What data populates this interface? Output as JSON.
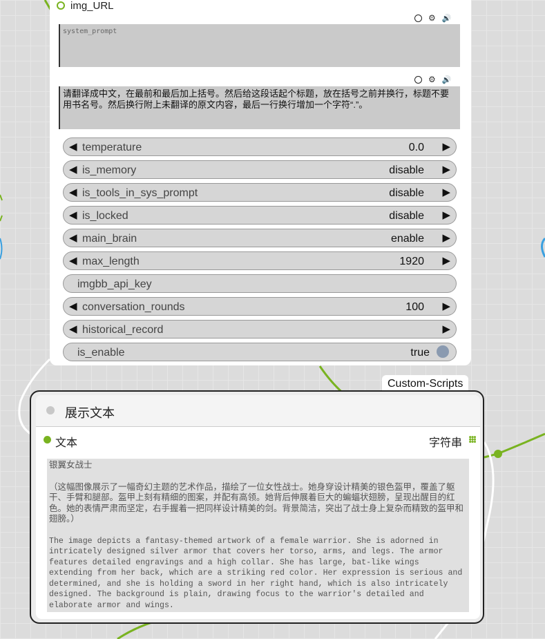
{
  "top_node": {
    "input": {
      "label": "img_URL"
    },
    "system_prompt": {
      "value": "system_prompt"
    },
    "user_prompt": {
      "value": "请翻译成中文，在最前和最后加上括号。然后给这段话起个标题，放在括号之前并换行，标题不要用书名号。然后换行附上未翻译的原文内容，最后一行换行增加一个字符“.”。"
    },
    "widgets": [
      {
        "label": "temperature",
        "value": "0.0"
      },
      {
        "label": "is_memory",
        "value": "disable"
      },
      {
        "label": "is_tools_in_sys_prompt",
        "value": "disable"
      },
      {
        "label": "is_locked",
        "value": "disable"
      },
      {
        "label": "main_brain",
        "value": "enable"
      },
      {
        "label": "max_length",
        "value": "1920"
      },
      {
        "label": "imgbb_api_key",
        "value": ""
      },
      {
        "label": "conversation_rounds",
        "value": "100"
      },
      {
        "label": "historical_record",
        "value": ""
      },
      {
        "label": "is_enable",
        "value": "true"
      }
    ]
  },
  "custom_scripts_tag": "Custom-Scripts",
  "display_node": {
    "title": "展示文本",
    "input_label": "文本",
    "output_label": "字符串",
    "output_text": {
      "title": "银翼女战士",
      "chinese": "（这幅图像展示了一幅奇幻主题的艺术作品，描绘了一位女性战士。她身穿设计精美的银色盔甲，覆盖了躯干、手臂和腿部。盔甲上刻有精细的图案，并配有高领。她背后伸展着巨大的蝙蝠状翅膀，呈现出醒目的红色。她的表情严肃而坚定，右手握着一把同样设计精美的剑。背景简洁，突出了战士身上复杂而精致的盔甲和翅膀。）",
      "english": "The image depicts a fantasy-themed artwork of a female warrior. She is adorned in intricately designed silver armor that covers her torso, arms, and legs. The armor features detailed engravings and a high collar. She has large, bat-like wings extending from her back, which are a striking red color. Her expression is serious and determined, and she is holding a sword in her right hand, which is also intricately designed. The background is plain, drawing focus to the warrior's detailed and elaborate armor and wings."
    }
  },
  "colors": {
    "accent": "#79b320",
    "wire": "#ffffff"
  }
}
